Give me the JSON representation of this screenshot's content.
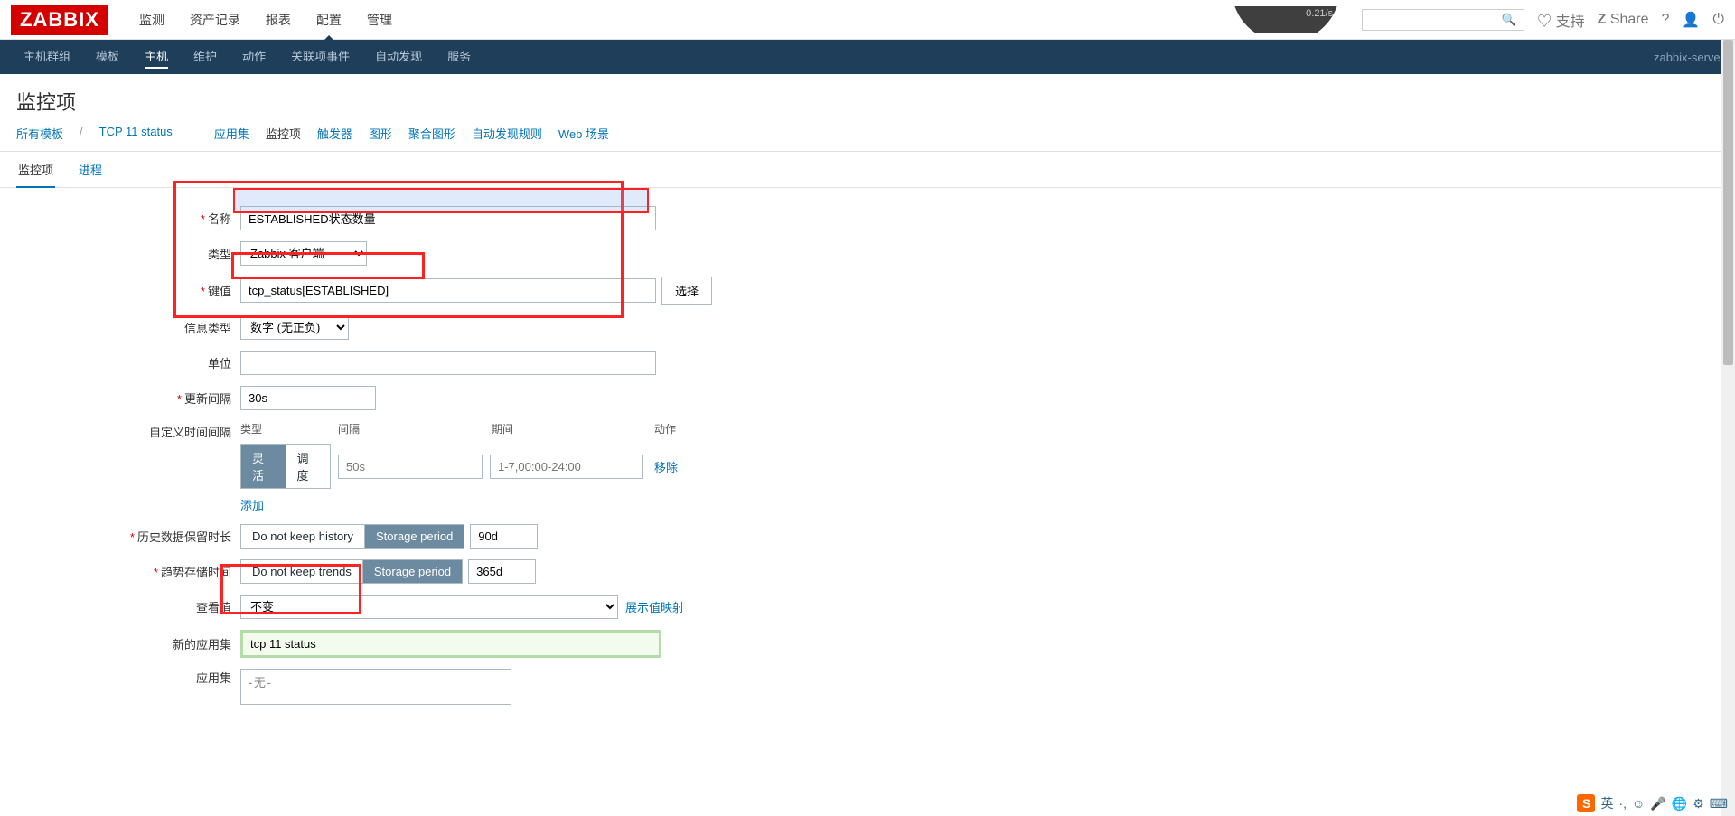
{
  "logo": "ZABBIX",
  "topnav": {
    "items": [
      "监测",
      "资产记录",
      "报表",
      "配置",
      "管理"
    ],
    "active": 3
  },
  "topright": {
    "support": "支持",
    "share": "Share",
    "gauge_value": "0.21/s"
  },
  "subnav": {
    "items": [
      "主机群组",
      "模板",
      "主机",
      "维护",
      "动作",
      "关联项事件",
      "自动发现",
      "服务"
    ],
    "active": 2,
    "server": "zabbix-server"
  },
  "page_title": "监控项",
  "breadcrumb": {
    "all_templates": "所有模板",
    "template": "TCP 11 status",
    "items": [
      "应用集",
      "监控项",
      "触发器",
      "图形",
      "聚合图形",
      "自动发现规则",
      "Web 场景"
    ],
    "active": 1
  },
  "tabs": {
    "items": [
      "监控项",
      "进程"
    ],
    "active": 0
  },
  "form": {
    "name": {
      "label": "名称",
      "value": "ESTABLISHED状态数量"
    },
    "type": {
      "label": "类型",
      "value": "Zabbix 客户端"
    },
    "key": {
      "label": "键值",
      "value": "tcp_status[ESTABLISHED]",
      "select_btn": "选择"
    },
    "info_type": {
      "label": "信息类型",
      "value": "数字 (无正负)"
    },
    "units": {
      "label": "单位",
      "value": ""
    },
    "update_interval": {
      "label": "更新间隔",
      "value": "30s"
    },
    "custom_interval": {
      "label": "自定义时间间隔",
      "headers": {
        "type": "类型",
        "interval": "间隔",
        "period": "期间",
        "action": "动作"
      },
      "seg": {
        "flex": "灵活",
        "sched": "调度"
      },
      "interval_ph": "50s",
      "period_ph": "1-7,00:00-24:00",
      "remove": "移除",
      "add": "添加"
    },
    "history": {
      "label": "历史数据保留时长",
      "no_keep": "Do not keep history",
      "storage": "Storage period",
      "value": "90d"
    },
    "trends": {
      "label": "趋势存储时间",
      "no_keep": "Do not keep trends",
      "storage": "Storage period",
      "value": "365d"
    },
    "valuemap": {
      "label": "查看值",
      "value": "不变",
      "link": "展示值映射"
    },
    "new_app": {
      "label": "新的应用集",
      "value": "tcp 11 status"
    },
    "apps": {
      "label": "应用集",
      "value": "-无-"
    }
  },
  "systray": {
    "ime": "英"
  }
}
